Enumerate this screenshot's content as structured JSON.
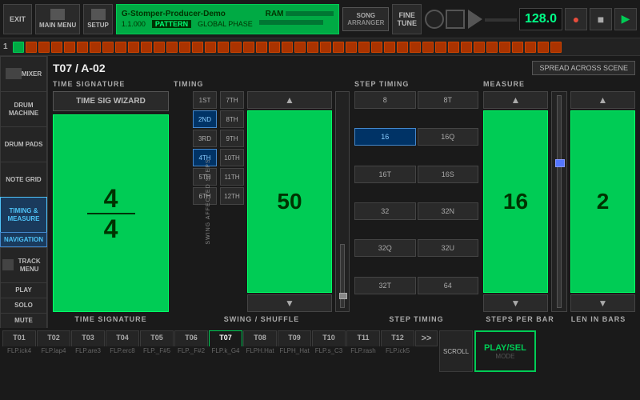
{
  "app": {
    "title": "G-Stomper-Producer-Demo",
    "position": "1.1.000",
    "pattern_label": "PATTERN",
    "global_phase_label": "GLOBAL PHASE",
    "ram_label": "RAM",
    "song_btn": "SONG",
    "arranger_label": "ARRANGER",
    "fine_tune_label": "FINE\nTUNE",
    "bpm": "128.0"
  },
  "nav": {
    "exit": "EXIT",
    "main_menu": "MAIN MENU",
    "setup": "SETUP",
    "mixer": "MIXER",
    "drum_machine": "DRUM\nMACHINE",
    "drum_pads": "DRUM\nPADS",
    "note_grid": "NOTE\nGRID",
    "timing_measure": "TIMING &\nMEASURE",
    "navigation": "NAVIGATION",
    "track_menu": "TRACK MENU",
    "play": "PLAY",
    "solo": "SOLO",
    "mute": "MUTE"
  },
  "panel": {
    "title": "T07 / A-02",
    "spread_btn": "SPREAD ACROSS SCENE"
  },
  "time_signature": {
    "label": "TIME SIGNATURE",
    "wizard_btn": "TIME SIG WIZARD",
    "numerator": "4",
    "denominator": "4",
    "bottom_label": "TIME SIGNATURE"
  },
  "timing": {
    "label": "TIMING",
    "swing_label": "SWING AFFECTED STEPS",
    "steps": [
      "1ST",
      "2ND",
      "3RD",
      "4TH",
      "5TH",
      "6TH"
    ],
    "steps2": [
      "7TH",
      "8TH",
      "9TH",
      "10TH",
      "11TH",
      "12TH"
    ],
    "active_steps": [
      "2ND",
      "4TH"
    ],
    "swing_value": "50",
    "bottom_label": "SWING / SHUFFLE"
  },
  "step_timing": {
    "label": "STEP TIMING",
    "values": [
      "8",
      "8T",
      "16",
      "16Q",
      "16T",
      "16S",
      "32",
      "32N",
      "32Q",
      "32U",
      "32T",
      "64"
    ],
    "active": "16",
    "bottom_label": "STEP TIMING"
  },
  "measure": {
    "label": "MEASURE",
    "steps_per_bar_value": "16",
    "len_in_bars_value": "2",
    "steps_per_bar_label": "STEPS PER BAR",
    "len_in_bars_label": "LEN IN BARS"
  },
  "track_bar": {
    "tabs": [
      "T01",
      "T02",
      "T03",
      "T04",
      "T05",
      "T06",
      "T07",
      "T08",
      "T09",
      "T10",
      "T11",
      "T12"
    ],
    "active_tab": "T07",
    "sub_labels": [
      "FLP.ick4",
      "FLP.lap4",
      "FLP.are3",
      "FLP.erc8",
      "FLP._F#5",
      "FLP._F#2",
      "FLP.k_G4",
      "FLPH.Hat",
      "FLPH_Hat",
      "FLP.s_C3",
      "FLP.rash",
      "FLP.ick5"
    ],
    "more_btn": ">>",
    "play_sel": "PLAY/SEL",
    "scroll": "SCROLL",
    "mode": "MODE"
  },
  "transport": {
    "record_shape": "●",
    "stop_shape": "■",
    "play_shape": "▶"
  }
}
